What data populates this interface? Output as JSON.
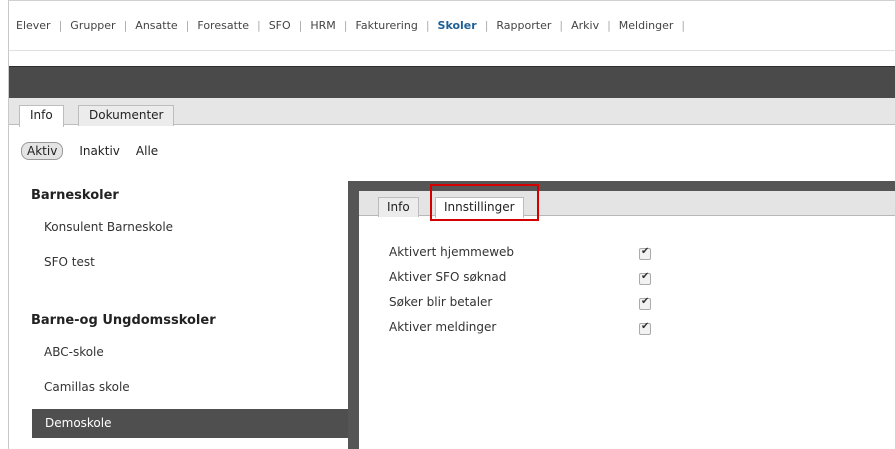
{
  "topnav": {
    "items": [
      {
        "label": "Elever"
      },
      {
        "label": "Grupper"
      },
      {
        "label": "Ansatte"
      },
      {
        "label": "Foresatte"
      },
      {
        "label": "SFO"
      },
      {
        "label": "HRM"
      },
      {
        "label": "Fakturering"
      },
      {
        "label": "Skoler",
        "active": true
      },
      {
        "label": "Rapporter"
      },
      {
        "label": "Arkiv"
      },
      {
        "label": "Meldinger"
      }
    ]
  },
  "outer_tabs": [
    {
      "label": "Info",
      "selected": true
    },
    {
      "label": "Dokumenter",
      "selected": false
    }
  ],
  "filter": {
    "options": [
      "Aktiv",
      "Inaktiv",
      "Alle"
    ],
    "selected": "Aktiv"
  },
  "schools": {
    "groups": [
      {
        "heading": "Barneskoler",
        "items": [
          "Konsulent Barneskole",
          "SFO test"
        ]
      },
      {
        "heading": "Barne-og Ungdomsskoler",
        "items": [
          "ABC-skole",
          "Camillas skole",
          "Demoskole"
        ]
      }
    ],
    "selected": "Demoskole"
  },
  "inner_tabs": [
    {
      "label": "Info",
      "selected": false
    },
    {
      "label": "Innstillinger",
      "selected": true
    }
  ],
  "settings": [
    {
      "label": "Aktivert hjemmeweb",
      "checked": true
    },
    {
      "label": "Aktiver SFO søknad",
      "checked": true
    },
    {
      "label": "Søker blir betaler",
      "checked": true
    },
    {
      "label": "Aktiver meldinger",
      "checked": true
    }
  ],
  "colors": {
    "nav_active": "#1d5f97",
    "dark_bar": "#4a4a4a",
    "selected_row": "#4f4f4f",
    "highlight": "#d40000"
  }
}
